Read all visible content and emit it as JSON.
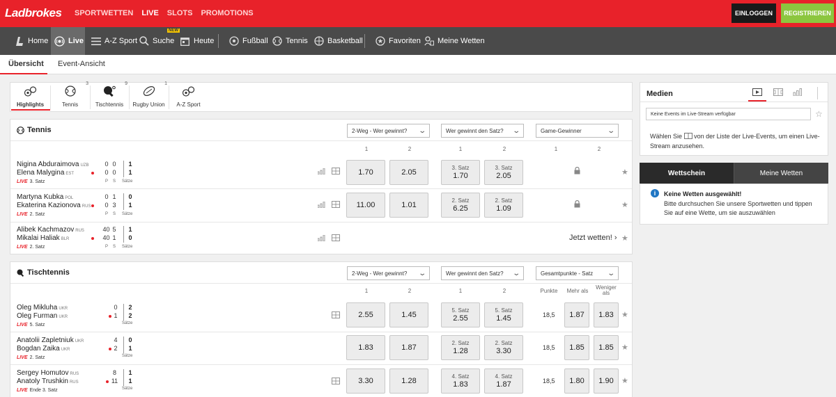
{
  "brand": "Ladbrokes",
  "top_nav": [
    "SPORTWETTEN",
    "LIVE",
    "SLOTS",
    "PROMOTIONS"
  ],
  "login_label": "EINLOGGEN",
  "register_label": "REGISTRIEREN",
  "sport_nav": {
    "home": "Home",
    "live": "Live",
    "az": "A-Z Sport",
    "search": "Suche",
    "new_badge": "NEW",
    "today": "Heute",
    "football": "Fußball",
    "tennis": "Tennis",
    "basketball": "Basketball",
    "favorites": "Favoriten",
    "my_bets": "Meine Wetten"
  },
  "sub_tabs": [
    "Übersicht",
    "Event-Ansicht"
  ],
  "sport_tabs": [
    {
      "label": "Highlights",
      "count": "",
      "icon": "balls-icon"
    },
    {
      "label": "Tennis",
      "count": "3",
      "icon": "tennis-ball-icon"
    },
    {
      "label": "Tischtennis",
      "count": "9",
      "icon": "ping-pong-icon"
    },
    {
      "label": "Rugby Union",
      "count": "1",
      "icon": "rugby-ball-icon"
    },
    {
      "label": "A-Z Sport",
      "count": "",
      "icon": "balls-icon"
    }
  ],
  "tennis": {
    "title": "Tennis",
    "dropdowns": [
      "2-Weg - Wer gewinnt?",
      "Wer gewinnt den Satz?",
      "Game-Gewinner"
    ],
    "col_heads": [
      "1",
      "2",
      "1",
      "2",
      "1",
      "2"
    ],
    "score_labels": {
      "p": "P",
      "s": "S",
      "saetze": "Sätze"
    },
    "rows": [
      {
        "p1": "Nigina Abduraimova",
        "c1": "UZB",
        "p2": "Elena Malygina",
        "c2": "EST",
        "live": "LIVE",
        "status": "3. Satz",
        "s1": [
          "0",
          "0",
          "1"
        ],
        "s2": [
          "0",
          "0",
          "1"
        ],
        "odd1": "1.70",
        "odd2": "2.05",
        "set_label1": "3. Satz",
        "set_odd1": "1.70",
        "set_label2": "3. Satz",
        "set_odd2": "2.05"
      },
      {
        "p1": "Martyna Kubka",
        "c1": "POL",
        "p2": "Ekaterina Kazionova",
        "c2": "RUS",
        "live": "LIVE",
        "status": "2. Satz",
        "s1": [
          "0",
          "1",
          "0"
        ],
        "s2": [
          "0",
          "3",
          "1"
        ],
        "odd1": "11.00",
        "odd2": "1.01",
        "set_label1": "2. Satz",
        "set_odd1": "6.25",
        "set_label2": "2. Satz",
        "set_odd2": "1.09"
      },
      {
        "p1": "Alibek Kachmazov",
        "c1": "RUS",
        "p2": "Mikalai Haliak",
        "c2": "BLR",
        "live": "LIVE",
        "status": "2. Satz",
        "s1": [
          "40",
          "5",
          "1"
        ],
        "s2": [
          "40",
          "1",
          "0"
        ],
        "cta": "Jetzt wetten!"
      }
    ]
  },
  "tischtennis": {
    "title": "Tischtennis",
    "dropdowns": [
      "2-Weg - Wer gewinnt?",
      "Wer gewinnt den Satz?",
      "Gesamtpunkte - Satz"
    ],
    "col_heads": [
      "1",
      "2",
      "1",
      "2",
      "Punkte",
      "Mehr als",
      "Weniger als"
    ],
    "saetze": "Sätze",
    "rows": [
      {
        "p1": "Oleg Mikluha",
        "c1": "UKR",
        "p2": "Oleg Furman",
        "c2": "UKR",
        "live": "LIVE",
        "status": "5. Satz",
        "s1": [
          "0",
          "2"
        ],
        "s2": [
          "1",
          "2"
        ],
        "odd1": "2.55",
        "odd2": "1.45",
        "set_label1": "5. Satz",
        "set_odd1": "2.55",
        "set_label2": "5. Satz",
        "set_odd2": "1.45",
        "points": "18,5",
        "over": "1.87",
        "under": "1.83"
      },
      {
        "p1": "Anatolii Zapletniuk",
        "c1": "UKR",
        "p2": "Bogdan Zaika",
        "c2": "UKR",
        "live": "LIVE",
        "status": "2. Satz",
        "s1": [
          "4",
          "0"
        ],
        "s2": [
          "2",
          "1"
        ],
        "odd1": "1.83",
        "odd2": "1.87",
        "set_label1": "2. Satz",
        "set_odd1": "1.28",
        "set_label2": "2. Satz",
        "set_odd2": "3.30",
        "points": "18,5",
        "over": "1.85",
        "under": "1.85"
      },
      {
        "p1": "Sergey Homutov",
        "c1": "RUS",
        "p2": "Anatoly Trushkin",
        "c2": "RUS",
        "live": "LIVE",
        "status": "Ende 3. Satz",
        "s1": [
          "8",
          "1"
        ],
        "s2": [
          "11",
          "1"
        ],
        "odd1": "3.30",
        "odd2": "1.28",
        "set_label1": "4. Satz",
        "set_odd1": "1.83",
        "set_label2": "4. Satz",
        "set_odd2": "1.87",
        "points": "18,5",
        "over": "1.80",
        "under": "1.90"
      }
    ]
  },
  "media": {
    "title": "Medien",
    "search_value": "Keine Events im Live-Stream verfügbar",
    "hint_a": "Wählen Sie",
    "hint_b": "von der Liste der Live-Events, um einen Live-",
    "hint_c": "Stream anzusehen."
  },
  "betslip": {
    "tab1": "Wettschein",
    "tab2": "Meine Wetten",
    "title": "Keine Wetten ausgewählt!",
    "text1": "Bitte durchsuchen Sie unsere Sportwetten und tippen",
    "text2": "Sie auf eine Wette, um sie auszuwählen"
  },
  "colors": {
    "brand_red": "#e8222a",
    "register_green": "#8cc63f",
    "info_blue": "#1f76c4"
  }
}
